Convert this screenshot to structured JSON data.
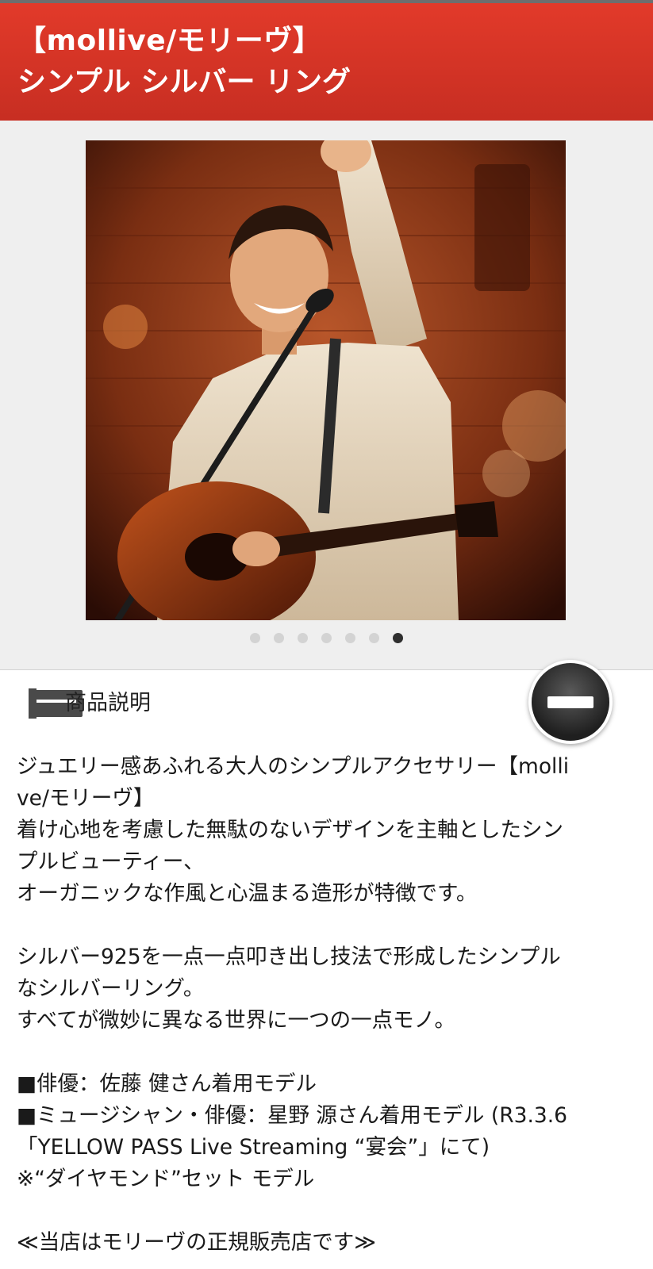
{
  "header": {
    "title_line1": "【mollive/モリーヴ】",
    "title_line2": "シンプル シルバー リング"
  },
  "gallery": {
    "image_description_icon": "photo",
    "slide_count": 7,
    "active_slide": 7
  },
  "description_section": {
    "label": "商品説明",
    "collapse_icon": "minus-icon",
    "lines": [
      "ジュエリー感あふれる大人のシンプルアクセサリー【molli",
      "ve/モリーヴ】",
      "着け心地を考慮した無駄のないデザインを主軸としたシン",
      "プルビューティー、",
      "オーガニックな作風と心温まる造形が特徴です。",
      "",
      "シルバー925を一点一点叩き出し技法で形成したシンプル",
      "なシルバーリング。",
      "すべてが微妙に異なる世界に一つの一点モノ。",
      "",
      "■俳優：佐藤 健さん着用モデル",
      "■ミュージシャン・俳優：星野 源さん着用モデル (R3.3.6",
      "「YELLOW PASS Live Streaming “宴会”」にて)",
      "※“ダイヤモンド”セット モデル",
      "",
      "≪当店はモリーヴの正規販売店です≫"
    ]
  },
  "colors": {
    "header_red": "#d9352a",
    "dot_active": "#2e2e2e",
    "dot_inactive": "#d3d3d3"
  }
}
